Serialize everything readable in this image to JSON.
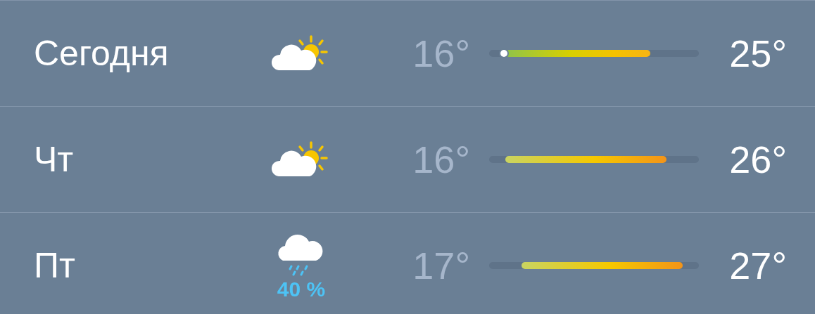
{
  "forecast": [
    {
      "day": "Сегодня",
      "kind": "partly-sunny",
      "low": "16°",
      "high": "25°",
      "current": {
        "level": 0.07
      }
    },
    {
      "day": "Чт",
      "kind": "partly-sunny",
      "low": "16°",
      "high": "26°"
    },
    {
      "day": "Пт",
      "kind": "rain",
      "precipitation": "40 %",
      "low": "17°",
      "high": "27°"
    }
  ]
}
